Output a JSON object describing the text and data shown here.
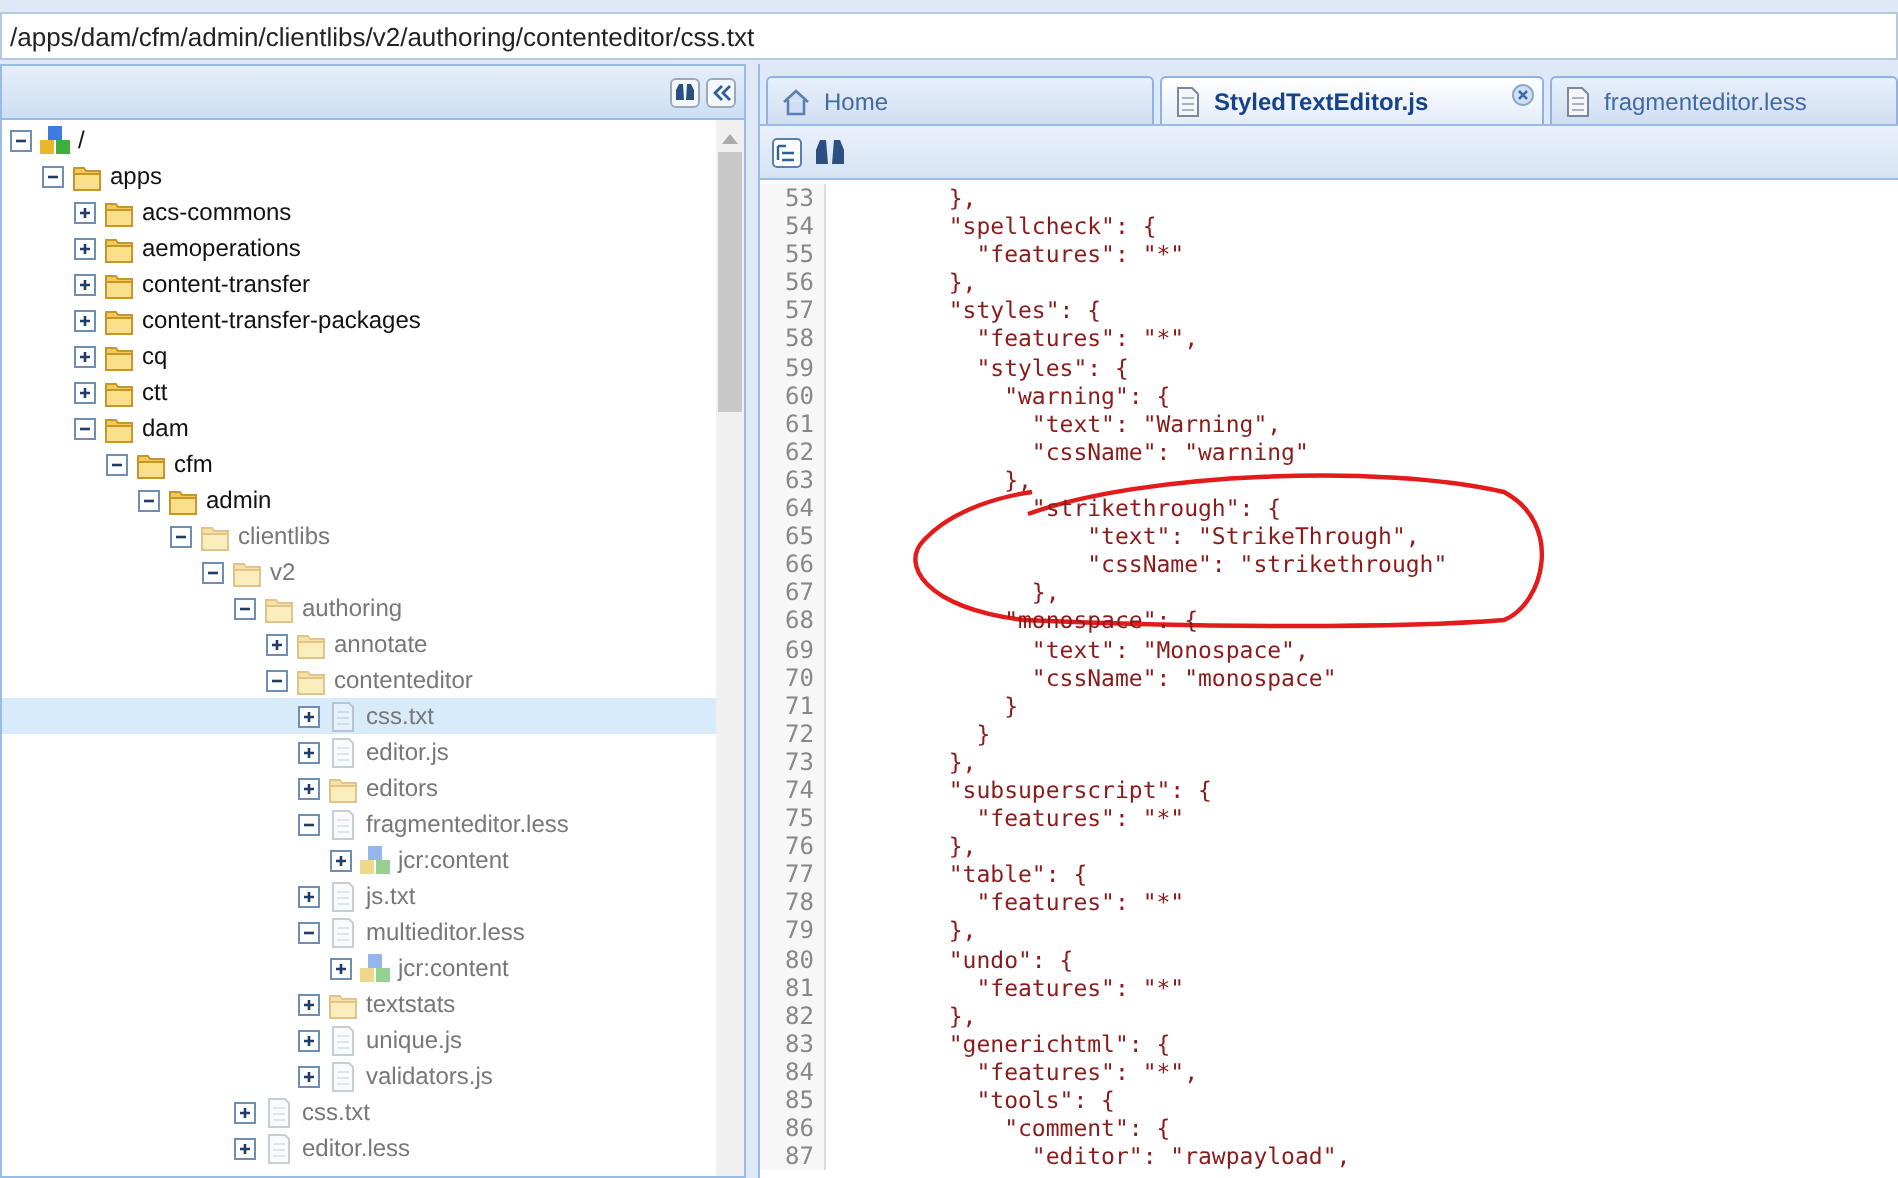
{
  "address_bar": {
    "value": "/apps/dam/cfm/admin/clientlibs/v2/authoring/contenteditor/css.txt"
  },
  "tree": [
    {
      "label": "/",
      "kind": "node",
      "expanded": true,
      "dimmed": false,
      "selected": false,
      "children": [
        {
          "label": "apps",
          "kind": "folder",
          "expanded": true,
          "dimmed": false,
          "selected": false,
          "children": [
            {
              "label": "acs-commons",
              "kind": "folder",
              "expanded": false,
              "dimmed": false,
              "selected": false
            },
            {
              "label": "aemoperations",
              "kind": "folder",
              "expanded": false,
              "dimmed": false,
              "selected": false
            },
            {
              "label": "content-transfer",
              "kind": "folder",
              "expanded": false,
              "dimmed": false,
              "selected": false
            },
            {
              "label": "content-transfer-packages",
              "kind": "folder",
              "expanded": false,
              "dimmed": false,
              "selected": false
            },
            {
              "label": "cq",
              "kind": "folder",
              "expanded": false,
              "dimmed": false,
              "selected": false
            },
            {
              "label": "ctt",
              "kind": "folder",
              "expanded": false,
              "dimmed": false,
              "selected": false
            },
            {
              "label": "dam",
              "kind": "folder",
              "expanded": true,
              "dimmed": false,
              "selected": false,
              "children": [
                {
                  "label": "cfm",
                  "kind": "folder",
                  "expanded": true,
                  "dimmed": false,
                  "selected": false,
                  "children": [
                    {
                      "label": "admin",
                      "kind": "folder",
                      "expanded": true,
                      "dimmed": false,
                      "selected": false,
                      "children": [
                        {
                          "label": "clientlibs",
                          "kind": "folder",
                          "expanded": true,
                          "dimmed": true,
                          "selected": false,
                          "children": [
                            {
                              "label": "v2",
                              "kind": "folder",
                              "expanded": true,
                              "dimmed": true,
                              "selected": false,
                              "children": [
                                {
                                  "label": "authoring",
                                  "kind": "folder",
                                  "expanded": true,
                                  "dimmed": true,
                                  "selected": false,
                                  "children": [
                                    {
                                      "label": "annotate",
                                      "kind": "folder",
                                      "expanded": false,
                                      "dimmed": true,
                                      "selected": false
                                    },
                                    {
                                      "label": "contenteditor",
                                      "kind": "folder",
                                      "expanded": true,
                                      "dimmed": true,
                                      "selected": false,
                                      "children": [
                                        {
                                          "label": "css.txt",
                                          "kind": "file",
                                          "expanded": false,
                                          "dimmed": true,
                                          "selected": true
                                        },
                                        {
                                          "label": "editor.js",
                                          "kind": "file",
                                          "expanded": false,
                                          "dimmed": true,
                                          "selected": false
                                        },
                                        {
                                          "label": "editors",
                                          "kind": "folder",
                                          "expanded": false,
                                          "dimmed": true,
                                          "selected": false
                                        },
                                        {
                                          "label": "fragmenteditor.less",
                                          "kind": "file",
                                          "expanded": true,
                                          "dimmed": true,
                                          "selected": false,
                                          "children": [
                                            {
                                              "label": "jcr:content",
                                              "kind": "node",
                                              "expanded": false,
                                              "dimmed": true,
                                              "selected": false
                                            }
                                          ]
                                        },
                                        {
                                          "label": "js.txt",
                                          "kind": "file",
                                          "expanded": false,
                                          "dimmed": true,
                                          "selected": false
                                        },
                                        {
                                          "label": "multieditor.less",
                                          "kind": "file",
                                          "expanded": true,
                                          "dimmed": true,
                                          "selected": false,
                                          "children": [
                                            {
                                              "label": "jcr:content",
                                              "kind": "node",
                                              "expanded": false,
                                              "dimmed": true,
                                              "selected": false
                                            }
                                          ]
                                        },
                                        {
                                          "label": "textstats",
                                          "kind": "folder",
                                          "expanded": false,
                                          "dimmed": true,
                                          "selected": false
                                        },
                                        {
                                          "label": "unique.js",
                                          "kind": "file",
                                          "expanded": false,
                                          "dimmed": true,
                                          "selected": false
                                        },
                                        {
                                          "label": "validators.js",
                                          "kind": "file",
                                          "expanded": false,
                                          "dimmed": true,
                                          "selected": false
                                        }
                                      ]
                                    }
                                  ]
                                },
                                {
                                  "label": "css.txt",
                                  "kind": "file",
                                  "expanded": false,
                                  "dimmed": true,
                                  "selected": false
                                },
                                {
                                  "label": "editor.less",
                                  "kind": "file",
                                  "expanded": false,
                                  "dimmed": true,
                                  "selected": false
                                }
                              ]
                            }
                          ]
                        }
                      ]
                    }
                  ]
                }
              ]
            }
          ]
        }
      ]
    }
  ],
  "tabs": [
    {
      "label": "Home",
      "kind": "home",
      "selected": false,
      "closable": false
    },
    {
      "label": "StyledTextEditor.js",
      "kind": "file",
      "selected": true,
      "closable": true
    },
    {
      "label": "fragmenteditor.less",
      "kind": "file",
      "selected": false,
      "closable": false
    }
  ],
  "code": [
    {
      "number": "53",
      "text": "        },"
    },
    {
      "number": "54",
      "text": "        \"spellcheck\": {"
    },
    {
      "number": "55",
      "text": "          \"features\": \"*\""
    },
    {
      "number": "56",
      "text": "        },"
    },
    {
      "number": "57",
      "text": "        \"styles\": {"
    },
    {
      "number": "58",
      "text": "          \"features\": \"*\","
    },
    {
      "number": "59",
      "text": "          \"styles\": {"
    },
    {
      "number": "60",
      "text": "            \"warning\": {"
    },
    {
      "number": "61",
      "text": "              \"text\": \"Warning\","
    },
    {
      "number": "62",
      "text": "              \"cssName\": \"warning\""
    },
    {
      "number": "63",
      "text": "            },"
    },
    {
      "number": "64",
      "text": "              \"strikethrough\": {"
    },
    {
      "number": "65",
      "text": "                  \"text\": \"StrikeThrough\","
    },
    {
      "number": "66",
      "text": "                  \"cssName\": \"strikethrough\""
    },
    {
      "number": "67",
      "text": "              },"
    },
    {
      "number": "68",
      "text": "            \"monospace\": {"
    },
    {
      "number": "69",
      "text": "              \"text\": \"Monospace\","
    },
    {
      "number": "70",
      "text": "              \"cssName\": \"monospace\""
    },
    {
      "number": "71",
      "text": "            }"
    },
    {
      "number": "72",
      "text": "          }"
    },
    {
      "number": "73",
      "text": "        },"
    },
    {
      "number": "74",
      "text": "        \"subsuperscript\": {"
    },
    {
      "number": "75",
      "text": "          \"features\": \"*\""
    },
    {
      "number": "76",
      "text": "        },"
    },
    {
      "number": "77",
      "text": "        \"table\": {"
    },
    {
      "number": "78",
      "text": "          \"features\": \"*\""
    },
    {
      "number": "79",
      "text": "        },"
    },
    {
      "number": "80",
      "text": "        \"undo\": {"
    },
    {
      "number": "81",
      "text": "          \"features\": \"*\""
    },
    {
      "number": "82",
      "text": "        },"
    },
    {
      "number": "83",
      "text": "        \"generichtml\": {"
    },
    {
      "number": "84",
      "text": "          \"features\": \"*\","
    },
    {
      "number": "85",
      "text": "          \"tools\": {"
    },
    {
      "number": "86",
      "text": "            \"comment\": {"
    },
    {
      "number": "87",
      "text": "              \"editor\": \"rawpayload\","
    }
  ]
}
